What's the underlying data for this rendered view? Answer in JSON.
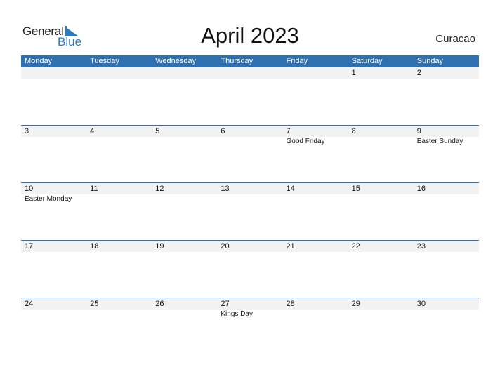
{
  "logo": {
    "general": "General",
    "blue": "Blue"
  },
  "title": "April 2023",
  "country": "Curacao",
  "days": [
    "Monday",
    "Tuesday",
    "Wednesday",
    "Thursday",
    "Friday",
    "Saturday",
    "Sunday"
  ],
  "weeks": [
    {
      "dates": [
        "",
        "",
        "",
        "",
        "",
        "1",
        "2"
      ],
      "events": [
        "",
        "",
        "",
        "",
        "",
        "",
        ""
      ]
    },
    {
      "dates": [
        "3",
        "4",
        "5",
        "6",
        "7",
        "8",
        "9"
      ],
      "events": [
        "",
        "",
        "",
        "",
        "Good Friday",
        "",
        "Easter Sunday"
      ]
    },
    {
      "dates": [
        "10",
        "11",
        "12",
        "13",
        "14",
        "15",
        "16"
      ],
      "events": [
        "Easter Monday",
        "",
        "",
        "",
        "",
        "",
        ""
      ]
    },
    {
      "dates": [
        "17",
        "18",
        "19",
        "20",
        "21",
        "22",
        "23"
      ],
      "events": [
        "",
        "",
        "",
        "",
        "",
        "",
        ""
      ]
    },
    {
      "dates": [
        "24",
        "25",
        "26",
        "27",
        "28",
        "29",
        "30"
      ],
      "events": [
        "",
        "",
        "",
        "Kings Day",
        "",
        "",
        ""
      ]
    }
  ]
}
